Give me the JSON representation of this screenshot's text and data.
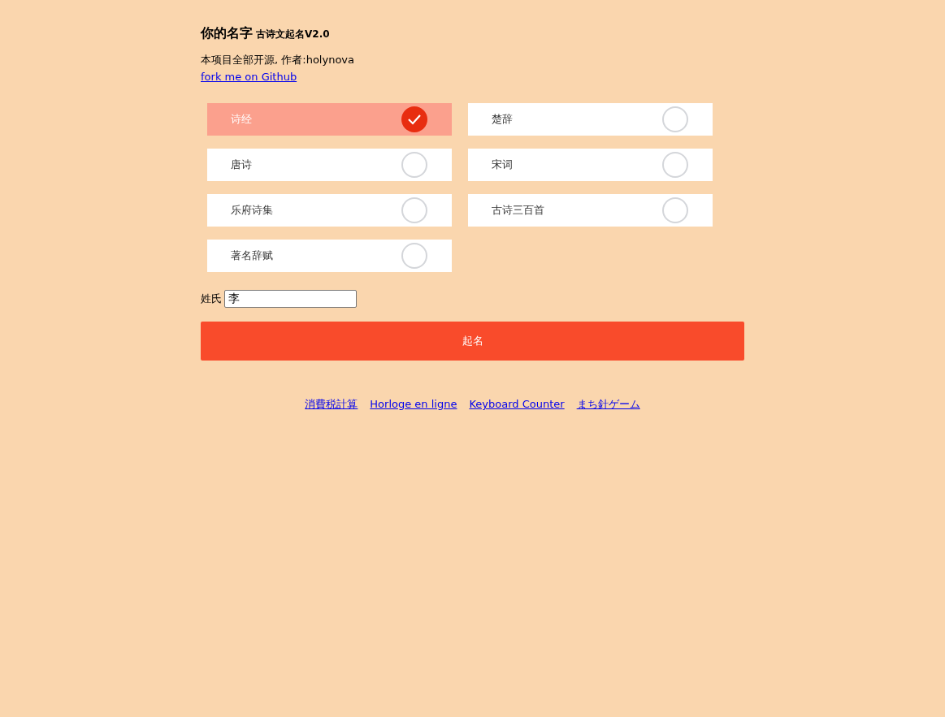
{
  "title": "你的名字",
  "subtitle": "古诗文起名V2.0",
  "intro": "本项目全部开源, 作者:holynova",
  "github_link": "fork me on Github",
  "options": [
    {
      "label": "诗经",
      "selected": true
    },
    {
      "label": "楚辞",
      "selected": false
    },
    {
      "label": "唐诗",
      "selected": false
    },
    {
      "label": "宋词",
      "selected": false
    },
    {
      "label": "乐府诗集",
      "selected": false
    },
    {
      "label": "古诗三百首",
      "selected": false
    },
    {
      "label": "著名辞赋",
      "selected": false
    }
  ],
  "surname": {
    "label": "姓氏",
    "value": "李"
  },
  "submit": "起名",
  "footer_links": [
    "消費税計算",
    "Horloge en ligne",
    "Keyboard Counter",
    "まち針ゲーム"
  ]
}
